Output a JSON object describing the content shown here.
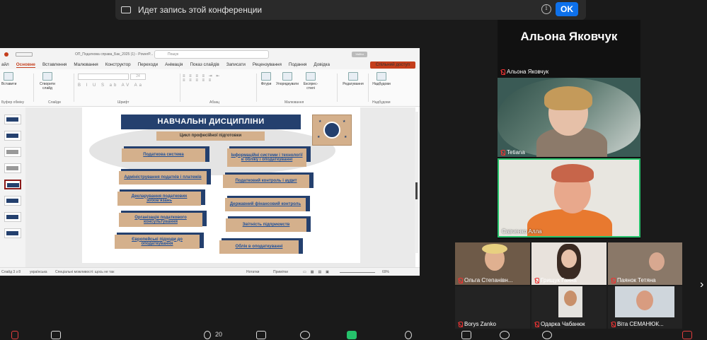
{
  "banner": {
    "text": "Идет запись этой конференции",
    "ok_label": "OK",
    "icon": "recording-icon",
    "info_icon": "info-icon"
  },
  "powerpoint": {
    "doc_title": "ОП_Податкова справа_Бак_2025 (1) - PowerP...",
    "search_placeholder": "Пошук",
    "signin": "Увійти",
    "menu": [
      "айл",
      "Основне",
      "Вставлення",
      "Малювання",
      "Конструктор",
      "Переходи",
      "Анімація",
      "Показ слайдів",
      "Записати",
      "Рецензування",
      "Подання",
      "Довідка"
    ],
    "active_menu": "Основне",
    "share_label": "Спільний доступ",
    "ribbon": {
      "paste": "Вставити",
      "new_slide": "Створити слайд",
      "font_size": "24",
      "shapes": "Фігури",
      "arrange": "Упорядкувати",
      "quick_styles": "Експрес-стилі",
      "editing": "Редагування",
      "addins": "Надбудови",
      "groups": [
        "Буфер обміну",
        "Слайди",
        "Шрифт",
        "Абзац",
        "Малювання",
        "Надбудови"
      ]
    },
    "status": {
      "slide": "Слайд 3 з 8",
      "language": "українська",
      "accessibility": "Спеціальні можливості: щось не так",
      "notes": "Нотатки",
      "comments": "Примітки",
      "zoom": "69%"
    },
    "slide": {
      "title": "НАВЧАЛЬНІ ДИСЦИПЛІНИ",
      "subtitle": "Цикл професійної підготовки",
      "left_items": [
        "Податкова система",
        "Адміністрування податків і платежів",
        "Декларування податкових зобов'язань",
        "Організація податкового консультування",
        "Європейські підходи до оподаткування"
      ],
      "right_items": [
        "Інформаційні системи і технології в обліку і оподаткуванні",
        "Податковий контроль і аудит",
        "Державний фінансовий контроль",
        "Звітність підприємств",
        "Облік в оподаткуванні"
      ]
    }
  },
  "participants": {
    "active_speaker": "Альона Яковчук",
    "top_tiles": [
      "Альона Яковчук",
      "Tetiana",
      "Савченко Алла"
    ],
    "bottom_tiles": [
      "Ольга Степанівн...",
      "Грищук Ганна",
      "Паянок Тетяна",
      "Borys Zanko",
      "Одарка Чабанюк",
      "Віта СЕМАНЮК..."
    ]
  },
  "toolbar": {
    "participant_count": "20",
    "colors": {
      "mic_muted": "#e33e3e",
      "accent": "#0e71eb",
      "ppt_red": "#c43e1c",
      "slide_navy": "#24406e",
      "box_tan": "#d4b08c"
    }
  }
}
